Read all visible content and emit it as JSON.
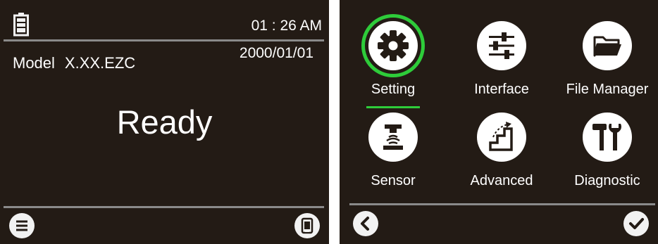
{
  "home_screen": {
    "status": {
      "time": "01 : 26 AM",
      "date": "2000/01/01"
    },
    "model": {
      "label": "Model",
      "value": "X.XX.EZC"
    },
    "status_message": "Ready",
    "icons": {
      "battery": "battery-icon",
      "menu": "menu-icon",
      "device": "device-icon"
    }
  },
  "menu_screen": {
    "items": [
      {
        "label": "Setting",
        "icon": "gear-icon",
        "selected": true
      },
      {
        "label": "Interface",
        "icon": "sliders-icon",
        "selected": false
      },
      {
        "label": "File Manager",
        "icon": "folder-icon",
        "selected": false
      },
      {
        "label": "Sensor",
        "icon": "sensor-icon",
        "selected": false
      },
      {
        "label": "Advanced",
        "icon": "stairs-icon",
        "selected": false
      },
      {
        "label": "Diagnostic",
        "icon": "tools-icon",
        "selected": false
      }
    ],
    "icons": {
      "back": "back-icon",
      "confirm": "check-icon"
    },
    "selection_color": "#2ecc3a"
  }
}
